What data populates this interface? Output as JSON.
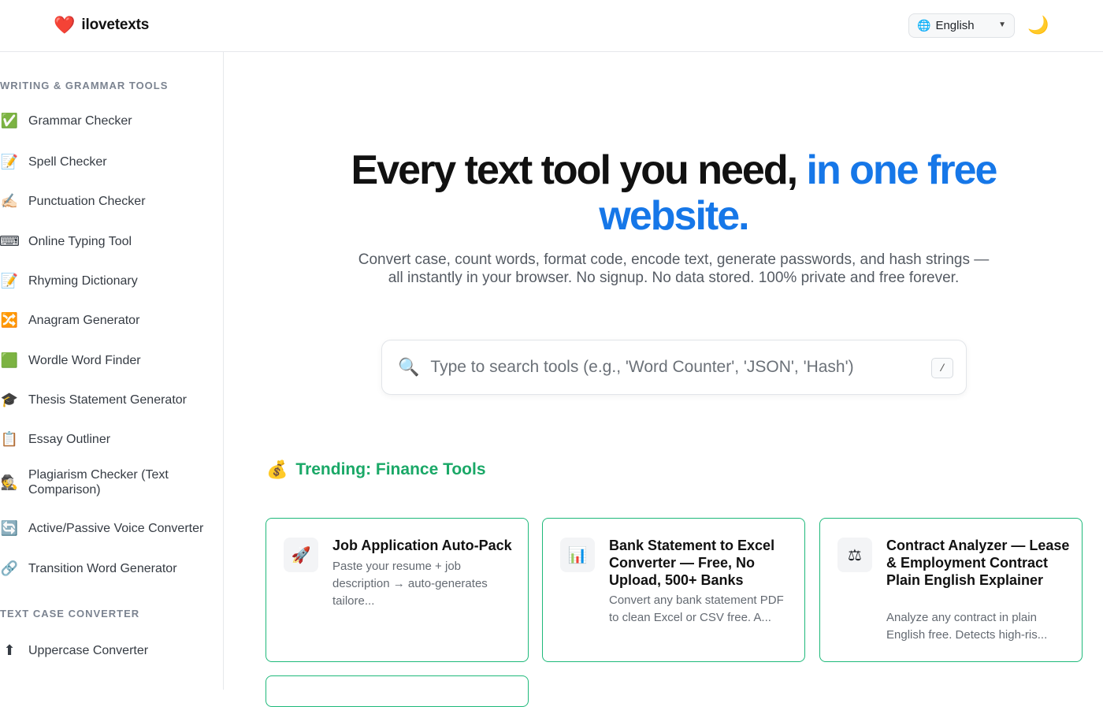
{
  "header": {
    "brand_icon": "heart-icon",
    "brand_name": "ilovetexts",
    "language": "English",
    "theme_icon": "moon-icon"
  },
  "sidebar": {
    "section_writing": "Writing & Grammar Tools",
    "writing_items": [
      {
        "icon": "✅",
        "icon_name": "check-mark-icon",
        "label": "Grammar Checker"
      },
      {
        "icon": "📝",
        "icon_name": "memo-icon",
        "label": "Spell Checker"
      },
      {
        "icon": "✍🏻",
        "icon_name": "writing-hand-icon",
        "label": "Punctuation Checker"
      },
      {
        "icon": "⌨",
        "icon_name": "keyboard-icon",
        "label": "Online Typing Tool"
      },
      {
        "icon": "📝",
        "icon_name": "memo-icon",
        "label": "Rhyming Dictionary"
      },
      {
        "icon": "🔀",
        "icon_name": "shuffle-icon",
        "label": "Anagram Generator"
      },
      {
        "icon": "🟩",
        "icon_name": "green-square-icon",
        "label": "Wordle Word Finder"
      },
      {
        "icon": "🎓",
        "icon_name": "graduation-cap-icon",
        "label": "Thesis Statement Generator"
      },
      {
        "icon": "📋",
        "icon_name": "clipboard-icon",
        "label": "Essay Outliner"
      },
      {
        "icon": "🕵",
        "icon_name": "detective-icon",
        "label": "Plagiarism Checker (Text Comparison)"
      },
      {
        "icon": "🔄",
        "icon_name": "refresh-icon",
        "label": "Active/Passive Voice Converter"
      },
      {
        "icon": "🔗",
        "icon_name": "link-icon",
        "label": "Transition Word Generator"
      }
    ],
    "section_case": "Text Case Converter",
    "case_items": [
      {
        "icon": "⬆",
        "icon_name": "up-arrow-icon",
        "label": "Uppercase Converter"
      }
    ]
  },
  "hero": {
    "title_main": "Every text tool you need, ",
    "title_accent": "in one free website.",
    "subtitle": "Convert case, count words, format code, encode text, generate passwords, and hash strings — all instantly in your browser. No signup. No data stored. 100% private and free forever."
  },
  "search": {
    "placeholder": "Type to search tools (e.g., 'Word Counter', 'JSON', 'Hash')",
    "shortcut": "/"
  },
  "trending": {
    "icon": "💰",
    "label": "Trending: Finance Tools"
  },
  "cards": [
    {
      "icon": "🚀",
      "icon_name": "rocket-icon",
      "title": "Job Application Auto-Pack",
      "desc": "Paste your resume + job description → auto-generates tailore..."
    },
    {
      "icon": "📊",
      "icon_name": "bar-chart-icon",
      "title": "Bank Statement to Excel Converter — Free, No Upload, 500+ Banks",
      "desc": "Convert any bank statement PDF to clean Excel or CSV free. A..."
    },
    {
      "icon": "⚖",
      "icon_name": "scales-icon",
      "title": "Contract Analyzer — Lease & Employment Contract Plain English Explainer",
      "desc": "Analyze any contract in plain English free. Detects high-ris..."
    }
  ]
}
